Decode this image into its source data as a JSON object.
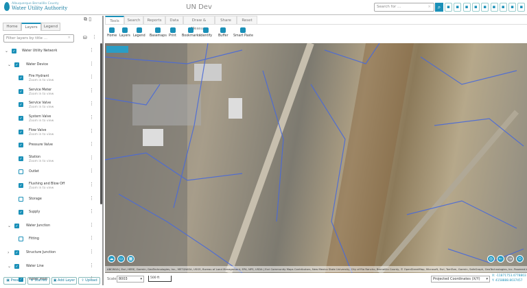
{
  "header": {
    "org": "Albuquerque Bernalillo County",
    "brand": "Water Utility Authority",
    "title": "UN Dev",
    "search_placeholder": "Search for ...",
    "icons": [
      "mobile-icon",
      "globe-icon",
      "filter-icon",
      "document-icon",
      "extent-icon",
      "layers-icon",
      "calendar-icon",
      "grid-icon",
      "user-icon"
    ]
  },
  "left": {
    "tabs": [
      "Home",
      "Layers",
      "Legend"
    ],
    "active_tab": "Layers",
    "filter_placeholder": "Filter layers by title ...",
    "tree": [
      {
        "label": "Water Utility Network",
        "level": 0,
        "expand": "v",
        "checked": true
      },
      {
        "label": "Water Device",
        "level": 1,
        "expand": "v",
        "checked": true
      },
      {
        "label": "Fire Hydrant",
        "sub": "Zoom in to view",
        "level": 2,
        "checked": true
      },
      {
        "label": "Service Meter",
        "sub": "Zoom in to view",
        "level": 2,
        "checked": true
      },
      {
        "label": "Service Valve",
        "sub": "Zoom in to view",
        "level": 2,
        "checked": true
      },
      {
        "label": "System Valve",
        "sub": "Zoom in to view",
        "level": 2,
        "checked": true
      },
      {
        "label": "Flow Valve",
        "sub": "Zoom in to view",
        "level": 2,
        "checked": true
      },
      {
        "label": "Pressure Valve",
        "level": 2,
        "checked": true
      },
      {
        "label": "Station",
        "sub": "Zoom in to view",
        "level": 2,
        "checked": true
      },
      {
        "label": "Outlet",
        "level": 2,
        "checked": false
      },
      {
        "label": "Flushing and Blow Off",
        "sub": "Zoom in to view",
        "level": 2,
        "checked": true
      },
      {
        "label": "Storage",
        "level": 2,
        "checked": false
      },
      {
        "label": "Supply",
        "level": 2,
        "checked": true
      },
      {
        "label": "Water Junction",
        "level": 1,
        "expand": "v",
        "checked": true
      },
      {
        "label": "Fitting",
        "level": 2,
        "checked": false
      },
      {
        "label": "Structure Junction",
        "level": 1,
        "expand": ">",
        "checked": true
      },
      {
        "label": "Water Line",
        "level": 1,
        "expand": "v",
        "checked": true
      },
      {
        "label": "Water Main",
        "level": 2,
        "checked": true
      }
    ],
    "buttons": [
      "Presets",
      "Starred",
      "Add Layer",
      "Upload"
    ]
  },
  "toolbar": {
    "tabs": [
      "Tools",
      "Search",
      "Reports",
      "Data",
      "Draw & Measure",
      "Share",
      "Reset"
    ],
    "active_tab": "Tools",
    "tools": [
      "Home",
      "Layers",
      "Legend",
      "Basemaps",
      "Print",
      "Bookmarks",
      "Identify",
      "Buffer",
      "Smart Paste"
    ]
  },
  "map": {
    "attribution": "ABCWUA | Esri, HERE, Garmin, GeoTechnologies, Inc., METI/NASA, USGS, Bureau of Land Management, EPA, NPS, USDA | Esri Community Maps Contributors, New Mexico State University, City of Rio Rancho, Bernalillo County, © OpenStreetMap, Microsoft, Esri, TomTom, Garmin, SafeGraph, GeoTechnologies, Inc.   Powered by Esri"
  },
  "status": {
    "scale_label": "Scale",
    "scale_value": "8003",
    "scalebar": "500 ft",
    "coord_system": "Projected Coordinates (X/Y)",
    "x": "X: -11871753.4778803",
    "y": "Y: 4158888.8037457"
  }
}
